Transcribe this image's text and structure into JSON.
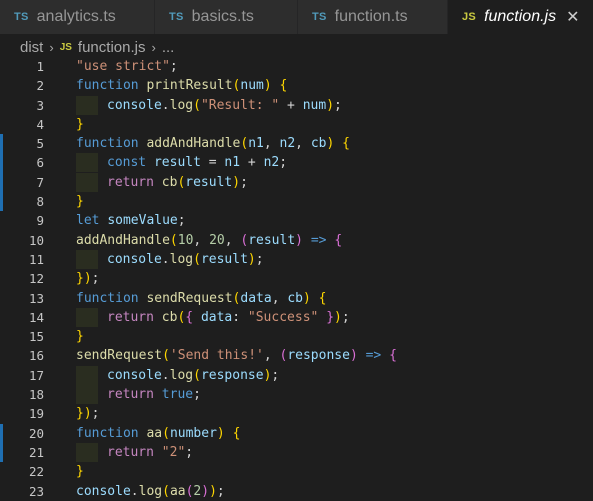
{
  "tabs": [
    {
      "badge": "TS",
      "label": "analytics.ts"
    },
    {
      "badge": "TS",
      "label": "basics.ts"
    },
    {
      "badge": "TS",
      "label": "function.ts"
    },
    {
      "badge": "JS",
      "label": "function.js",
      "close": "✕"
    }
  ],
  "breadcrumb": {
    "folder": "dist",
    "sep": "›",
    "badge": "JS",
    "file": "function.js",
    "more": "..."
  },
  "editor": {
    "lines": [
      {
        "n": "1",
        "text": "\"use strict\";"
      },
      {
        "n": "2",
        "text": "function printResult(num) {"
      },
      {
        "n": "3",
        "text": "console.log(\"Result: \" + num);"
      },
      {
        "n": "4",
        "text": "}"
      },
      {
        "n": "5",
        "text": "function addAndHandle(n1, n2, cb) {"
      },
      {
        "n": "6",
        "text": "const result = n1 + n2;"
      },
      {
        "n": "7",
        "text": "return cb(result);"
      },
      {
        "n": "8",
        "text": "}"
      },
      {
        "n": "9",
        "text": "let someValue;"
      },
      {
        "n": "10",
        "text": "addAndHandle(10, 20, (result) => {"
      },
      {
        "n": "11",
        "text": "console.log(result);"
      },
      {
        "n": "12",
        "text": "});"
      },
      {
        "n": "13",
        "text": "function sendRequest(data, cb) {"
      },
      {
        "n": "14",
        "text": "return cb({ data: \"Success\" });"
      },
      {
        "n": "15",
        "text": "}"
      },
      {
        "n": "16",
        "text": "sendRequest('Send this!', (response) => {"
      },
      {
        "n": "17",
        "text": "console.log(response);"
      },
      {
        "n": "18",
        "text": "return true;"
      },
      {
        "n": "19",
        "text": "});"
      },
      {
        "n": "20",
        "text": "function aa(number) {"
      },
      {
        "n": "21",
        "text": "return \"2\";"
      },
      {
        "n": "22",
        "text": "}"
      },
      {
        "n": "23",
        "text": "console.log(aa(2));"
      }
    ]
  },
  "colors": {
    "ts_badge": "#519aba",
    "js_badge": "#cbcb41",
    "keyword": "#569cd6",
    "function_name": "#dcdcaa",
    "variable": "#9cdcfe",
    "string": "#ce9178",
    "number": "#b5cea8",
    "gutter_change": "#1f6fb2"
  }
}
